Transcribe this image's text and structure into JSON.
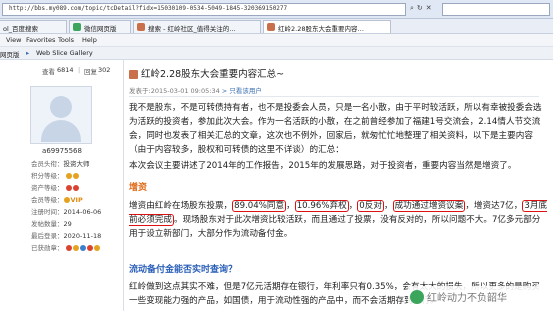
{
  "browser": {
    "url": "http://bbs.my089.com/topic/tcDetail?fidx=15030109-0534-5049-1845-320369150277",
    "tabs": [
      {
        "label": "搜索 - 红岭社区_值得关注的…",
        "active": false
      },
      {
        "label": "红岭2.28股东大会重要内容…",
        "active": true
      }
    ],
    "left_tab_fragments": [
      "ol_百度搜索",
      "微信网页版"
    ],
    "menu": [
      "View",
      "Favorites",
      "Tools",
      "Help"
    ],
    "favorites_bar": {
      "left_fragment": "网页版",
      "suggested": "Suggested Sites",
      "gallery": "Web Slice Gallery"
    },
    "colors": {
      "chrome": "#dfe8f4",
      "accent_red": "#d11111",
      "orange": "#e06a17",
      "blue": "#2a5fb8",
      "green": "#3ba55b"
    }
  },
  "sidebar": {
    "stats": {
      "views_label": "查看",
      "views": "6814",
      "sep": "|",
      "replies_label": "回复",
      "replies": "302"
    },
    "username": "a69975568",
    "profile": [
      {
        "label": "会员头衔：",
        "value": "投资大师"
      },
      {
        "label": "积分等级：",
        "value": ""
      },
      {
        "label": "资产等级：",
        "value": ""
      },
      {
        "label": "会员等级：",
        "value": "VIP"
      },
      {
        "label": "注册时间：",
        "value": "2014-06-06"
      },
      {
        "label": "发帖数量：",
        "value": "29"
      },
      {
        "label": "最后登录：",
        "value": "2020-11-18"
      },
      {
        "label": "已获勋章：",
        "value": ""
      }
    ]
  },
  "post": {
    "title": "红岭2.28股东大会重要内容汇总~",
    "meta": "发表于:2015-03-01 09:05:34",
    "meta_extra": " > 只看该用户",
    "p1": "我不是股东，不是可转债持有者，也不是投委会人员，只是一名小散，由于平时较活跃，所以有幸被投委会选为活跃的投资者，参加此次大会。作为一名活跃的小散，在之前曾经参加了福建1号交流会，2.14情人节交流会，同时也发表了相关汇总的文章，这次也不例外，回家后，就匆忙忙地整理了相关资料，以下是主要内容（由于内容较多，股权和可转债的这里不详谈）的汇总：",
    "p2": "本次会议主要讲述了2014年的工作报告，2015年的发展思路，对于投资者，重要内容当然是增资了。",
    "h_increase": "增资",
    "p3_a": "增资由红岭在场股东投票，",
    "p3_hl1": "89.04%同意",
    "p3_c1": "，",
    "p3_hl2": "10.96%弃权",
    "p3_c2": "，",
    "p3_hl3": "0反对",
    "p3_c3": "，",
    "p3_hl4": "成功通过增资议案",
    "p3_b": "，增资达7亿，",
    "p3_hl5": "3月底前必须完成",
    "p3_c": "。现场股东对于此次增资比较活跃，而且通过了投票，没有反对的，所以问题不大。7亿多元部分用于设立新部门，大部分作为流动备付金。",
    "h_liquidity": "流动备付金能否实时查询？",
    "p4": "红岭做到这点其实不难，但是7亿元活期存在银行，年利率只有0.35%，会有太大的损失，所以更多的是购买一些变现能力强的产品，如国债，用于流动性强的产品中，而不会活期存到银行。",
    "watermark": "红岭动力不负韶华"
  }
}
